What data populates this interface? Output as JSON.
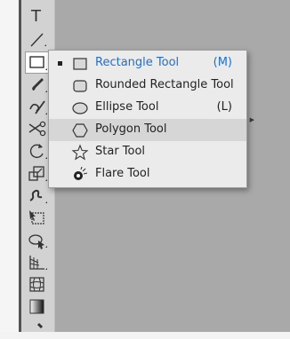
{
  "toolbar": {
    "type_tool_glyph": "T"
  },
  "flyout": {
    "items": [
      {
        "label": "Rectangle Tool",
        "shortcut": "(M)",
        "icon": "rectangle-icon"
      },
      {
        "label": "Rounded Rectangle Tool",
        "shortcut": "",
        "icon": "rounded-rectangle-icon"
      },
      {
        "label": "Ellipse Tool",
        "shortcut": "(L)",
        "icon": "ellipse-icon"
      },
      {
        "label": "Polygon Tool",
        "shortcut": "",
        "icon": "polygon-icon"
      },
      {
        "label": "Star Tool",
        "shortcut": "",
        "icon": "star-icon"
      },
      {
        "label": "Flare Tool",
        "shortcut": "",
        "icon": "flare-icon"
      }
    ],
    "active_item": "Rectangle Tool",
    "hovered_item": "Polygon Tool"
  },
  "colors": {
    "active_text": "#1c6fd1",
    "toolbar_bg": "#d2d2d2",
    "canvas_bg": "#a9a9a9",
    "flyout_bg": "#ebebeb",
    "hover_bg": "#d6d6d6"
  }
}
